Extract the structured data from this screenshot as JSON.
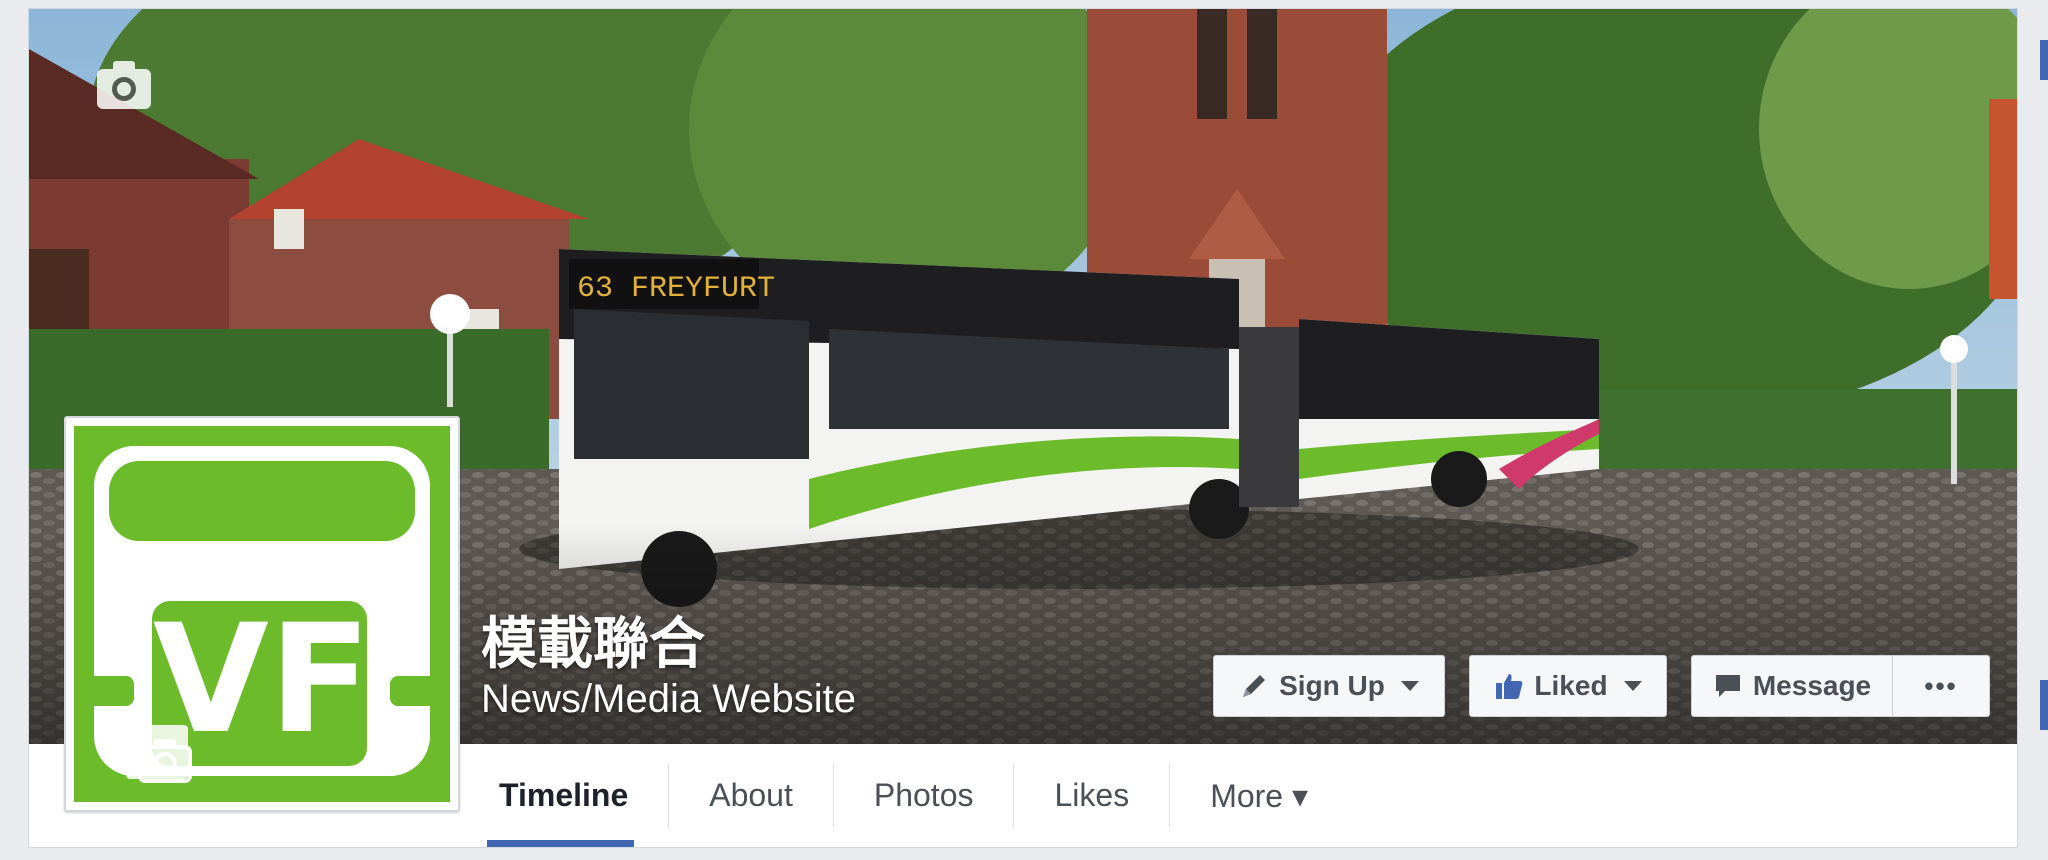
{
  "page": {
    "name": "模載聯合",
    "category": "News/Media Website"
  },
  "buttons": {
    "sign_up": "Sign Up",
    "liked": "Liked",
    "message": "Message",
    "more_actions": "•••"
  },
  "tabs": [
    {
      "label": "Timeline",
      "active": true
    },
    {
      "label": "About"
    },
    {
      "label": "Photos"
    },
    {
      "label": "Likes"
    },
    {
      "label": "More ▾"
    }
  ],
  "cover": {
    "bus_route": "63",
    "bus_destination": "FREYFURT"
  },
  "profile_logo": {
    "text": "VF",
    "color": "#6cbb2b"
  },
  "colors": {
    "accent": "#4267b2",
    "brand_green": "#6cbb2b"
  },
  "icons": [
    "camera-icon",
    "pencil-icon",
    "thumbs-up-icon",
    "message-icon",
    "caret-down-icon"
  ]
}
